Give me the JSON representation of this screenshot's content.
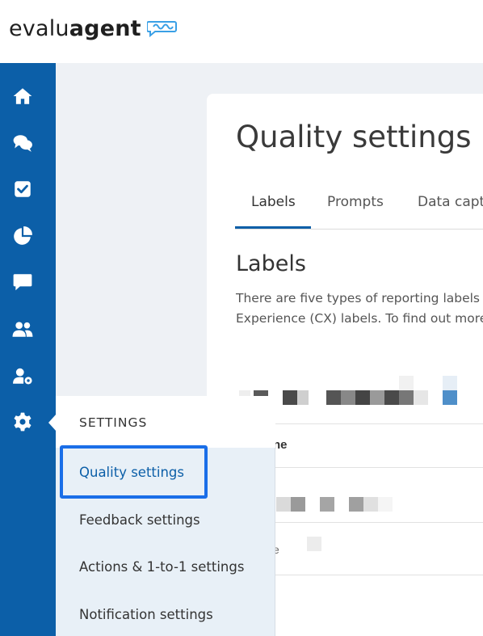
{
  "brand": {
    "logo_part1": "evalu",
    "logo_part2": "agent",
    "logo_mark_icon": "speech-wave-icon"
  },
  "sidebar": {
    "items": [
      {
        "name": "home",
        "icon": "home-icon"
      },
      {
        "name": "conversations",
        "icon": "chat-bubbles-icon"
      },
      {
        "name": "evaluations",
        "icon": "checkbox-icon"
      },
      {
        "name": "reports",
        "icon": "pie-chart-icon"
      },
      {
        "name": "feedback",
        "icon": "message-icon"
      },
      {
        "name": "users",
        "icon": "users-icon"
      },
      {
        "name": "user-settings",
        "icon": "user-gear-icon"
      },
      {
        "name": "settings",
        "icon": "gear-icon"
      }
    ]
  },
  "main": {
    "title": "Quality settings",
    "tabs": [
      {
        "label": "Labels"
      },
      {
        "label": "Prompts"
      },
      {
        "label": "Data capt"
      }
    ],
    "section_title": "Labels",
    "description_line1": "There are five types of reporting labels",
    "description_line2": "Experience (CX) labels. To find out more",
    "table_header_fragment": "ne",
    "cell_fragment": "e"
  },
  "settings_menu": {
    "heading": "SETTINGS",
    "items": [
      {
        "label": "Quality settings"
      },
      {
        "label": "Feedback settings"
      },
      {
        "label": "Actions & 1-to-1 settings"
      },
      {
        "label": "Notification settings"
      }
    ]
  },
  "colors": {
    "sidebar": "#0c5fa8",
    "accent": "#0c5fa8",
    "focus": "#1a6ee8",
    "menu_bg": "#e8f0f7"
  }
}
